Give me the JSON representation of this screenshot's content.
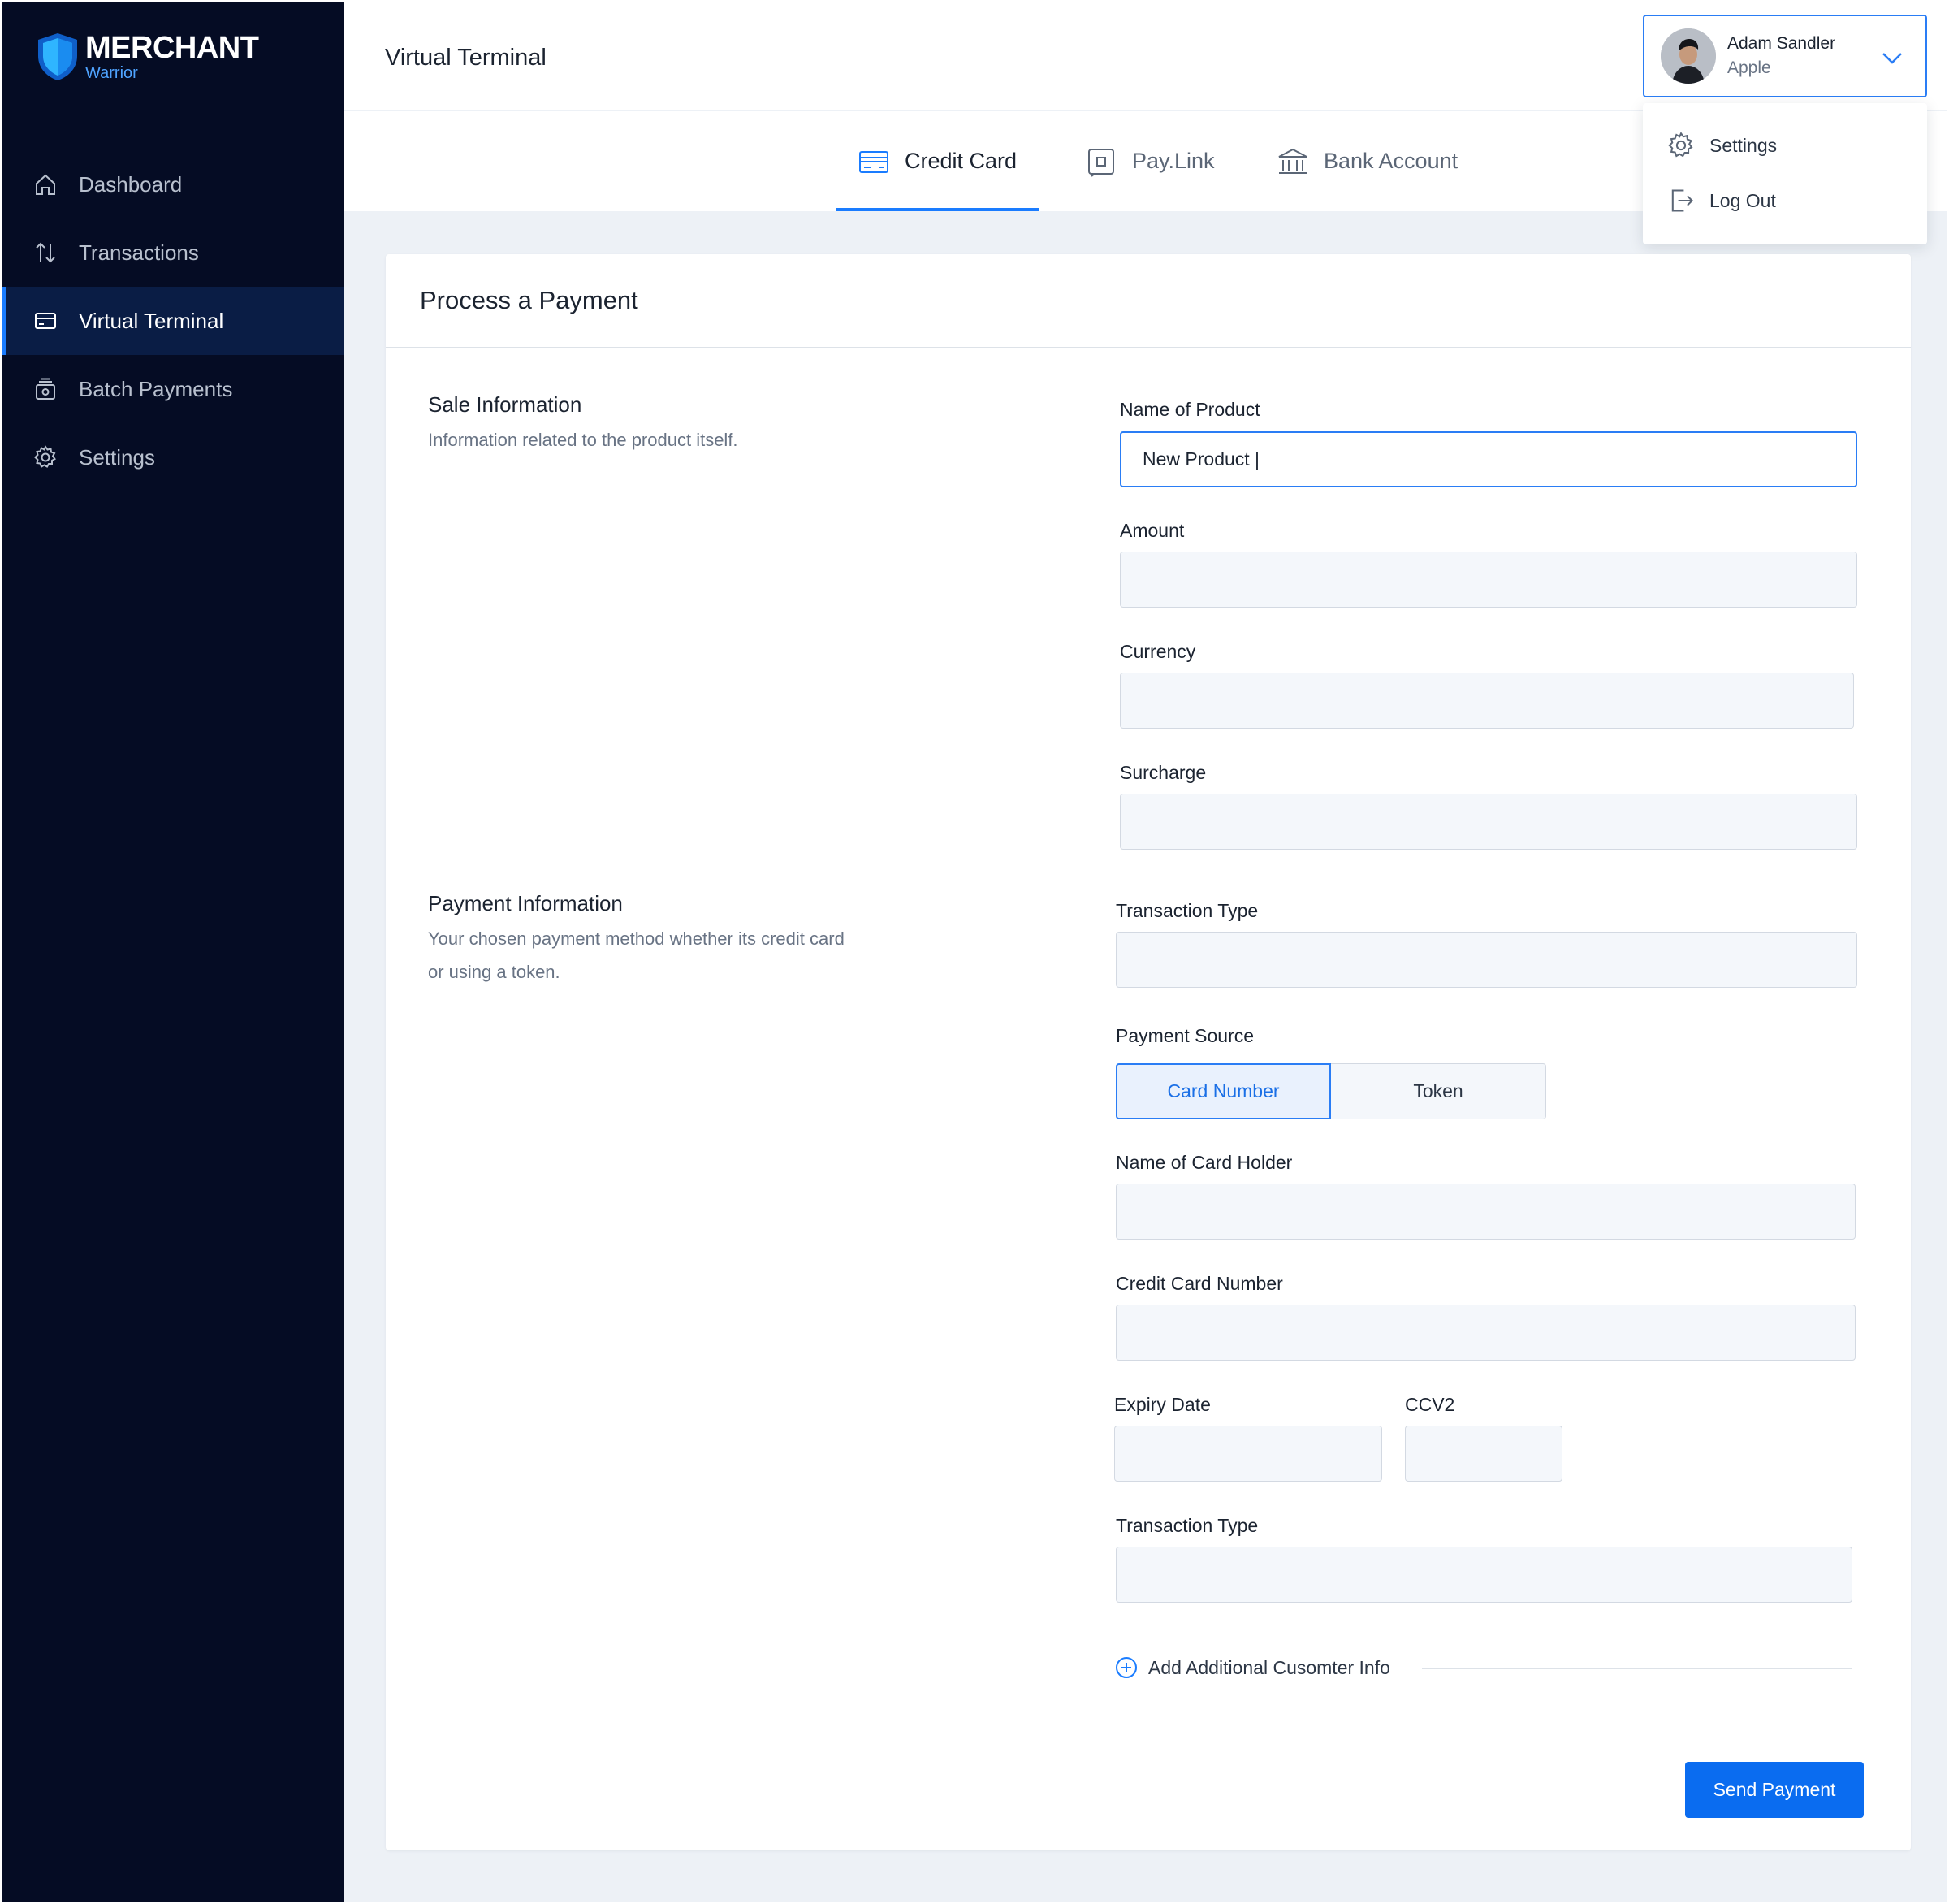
{
  "brand": {
    "title": "MERCHANT",
    "subtitle": "Warrior"
  },
  "sidebar": {
    "items": [
      {
        "label": "Dashboard",
        "icon": "home-icon"
      },
      {
        "label": "Transactions",
        "icon": "arrows-updown-icon"
      },
      {
        "label": "Virtual Terminal",
        "icon": "card-icon",
        "active": true
      },
      {
        "label": "Batch Payments",
        "icon": "batch-icon"
      },
      {
        "label": "Settings",
        "icon": "gear-icon"
      }
    ]
  },
  "header": {
    "title": "Virtual Terminal"
  },
  "tabs": [
    {
      "label": "Credit Card",
      "icon": "credit-card-icon",
      "active": true
    },
    {
      "label": "Pay.Link",
      "icon": "paylink-icon"
    },
    {
      "label": "Bank Account",
      "icon": "bank-icon"
    }
  ],
  "user": {
    "name": "Adam Sandler",
    "org": "Apple"
  },
  "user_menu": {
    "settings": "Settings",
    "logout": "Log Out"
  },
  "card": {
    "title": "Process a Payment"
  },
  "sale_info": {
    "title": "Sale Information",
    "desc": "Information related to the product itself."
  },
  "payment_info": {
    "title": "Payment Information",
    "desc_line1": "Your chosen payment method whether its credit card",
    "desc_line2": "or using a token."
  },
  "fields": {
    "product_name": {
      "label": "Name of Product",
      "value": "New Product |"
    },
    "amount": {
      "label": "Amount",
      "value": ""
    },
    "currency": {
      "label": "Currency",
      "value": ""
    },
    "surcharge": {
      "label": "Surcharge",
      "value": ""
    },
    "transaction_type": {
      "label": "Transaction Type",
      "value": ""
    },
    "payment_source": {
      "label": "Payment Source",
      "options": [
        "Card Number",
        "Token"
      ],
      "selected": "Card Number"
    },
    "card_holder": {
      "label": "Name of Card Holder",
      "value": ""
    },
    "card_number": {
      "label": "Credit Card Number",
      "value": ""
    },
    "expiry": {
      "label": "Expiry Date",
      "value": ""
    },
    "ccv2": {
      "label": "CCV2",
      "value": ""
    },
    "transaction_type_2": {
      "label": "Transaction Type",
      "value": ""
    }
  },
  "add_info": "Add Additional Cusomter Info",
  "send_button": "Send Payment",
  "colors": {
    "sidebar_bg": "#050c24",
    "sidebar_active": "#0a1d45",
    "accent": "#1a7cff",
    "button": "#0a6cf0",
    "page_bg": "#edf1f6"
  }
}
